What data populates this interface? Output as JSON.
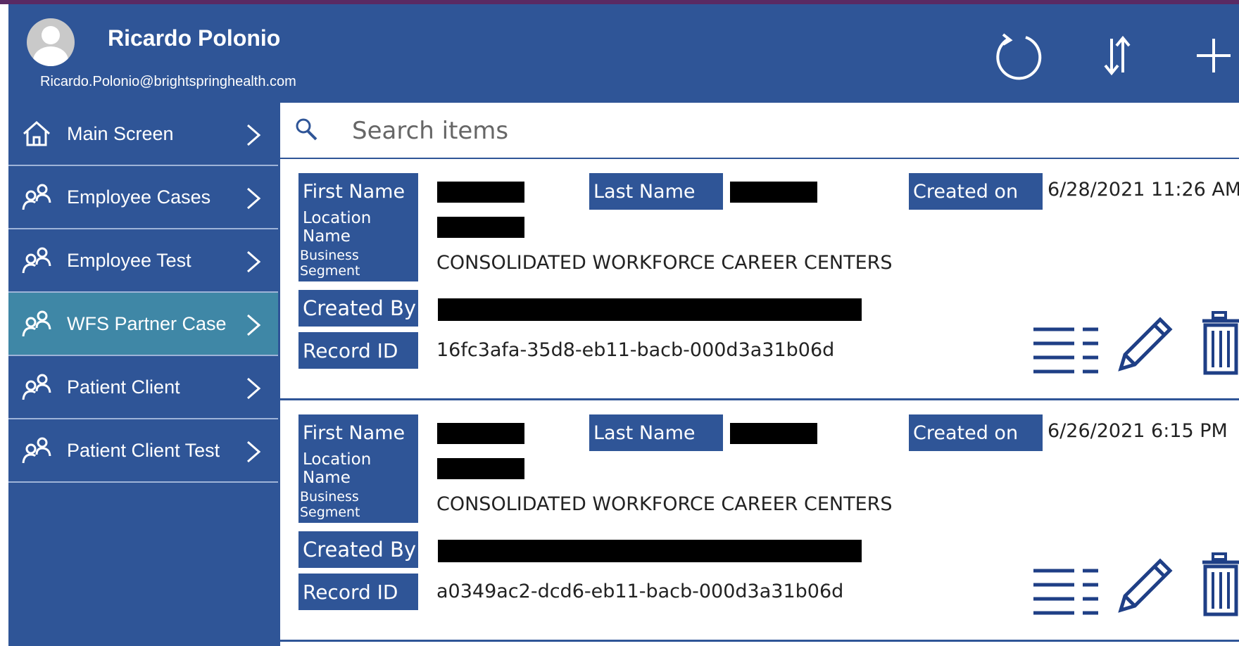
{
  "header": {
    "user_name": "Ricardo Polonio",
    "user_email": "Ricardo.Polonio@brightspringhealth.com",
    "actions": [
      "refresh-icon",
      "sort-icon",
      "add-icon"
    ]
  },
  "sidebar": {
    "items": [
      {
        "label": "Main Screen",
        "icon": "home-icon",
        "active": false
      },
      {
        "label": "Employee Cases",
        "icon": "people-icon",
        "active": false
      },
      {
        "label": "Employee Test",
        "icon": "people-icon",
        "active": false
      },
      {
        "label": "WFS Partner Case",
        "icon": "people-icon",
        "active": true
      },
      {
        "label": "Patient Client",
        "icon": "people-icon",
        "active": false
      },
      {
        "label": "Patient Client Test",
        "icon": "people-icon",
        "active": false
      }
    ]
  },
  "search": {
    "placeholder": "Search items",
    "value": ""
  },
  "labels": {
    "first_name": "First Name",
    "last_name": "Last Name",
    "created_on": "Created on",
    "location_name": "Location Name",
    "business_segment": "Business Segment",
    "created_by": "Created By",
    "record_id": "Record ID"
  },
  "records": [
    {
      "created_on": "6/28/2021 11:26 AM",
      "business_segment": "CONSOLIDATED WORKFORCE CAREER CENTERS",
      "record_id": "16fc3afa-35d8-eb11-bacb-000d3a31b06d"
    },
    {
      "created_on": "6/26/2021 6:15 PM",
      "business_segment": "CONSOLIDATED WORKFORCE CAREER CENTERS",
      "record_id": "a0349ac2-dcd6-eb11-bacb-000d3a31b06d"
    }
  ],
  "colors": {
    "primary": "#2f5597",
    "active_nav": "#3f87a6",
    "redaction": "#000000"
  }
}
